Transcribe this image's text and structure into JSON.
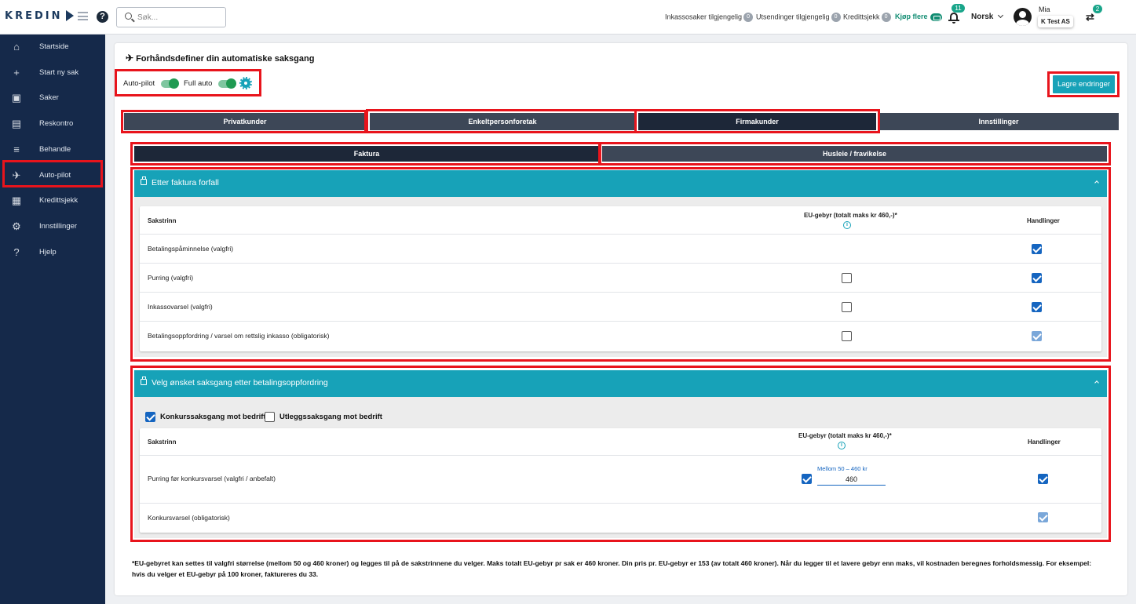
{
  "app": {
    "logo_text": "KREDIN"
  },
  "search": {
    "placeholder": "Søk..."
  },
  "header": {
    "stats": [
      {
        "label": "Inkassosaker tilgjengelig",
        "count": "0"
      },
      {
        "label": "Utsendinger tilgjengelig",
        "count": "0"
      },
      {
        "label": "Kredittsjekk",
        "count": "0"
      }
    ],
    "buy_more": "Kjøp flere",
    "notifications_count": "11",
    "language": "Norsk",
    "user_name": "Mia",
    "company": "K Test AS",
    "switch_count": "2"
  },
  "sidebar": {
    "items": [
      {
        "label": "Startside",
        "icon": "home-icon",
        "glyph": "⌂"
      },
      {
        "label": "Start ny sak",
        "icon": "plus-icon",
        "glyph": "+"
      },
      {
        "label": "Saker",
        "icon": "briefcase-icon",
        "glyph": "▣"
      },
      {
        "label": "Reskontro",
        "icon": "document-icon",
        "glyph": "▤"
      },
      {
        "label": "Behandle",
        "icon": "checklist-icon",
        "glyph": "≡"
      },
      {
        "label": "Auto-pilot",
        "icon": "airplane-icon",
        "glyph": "✈"
      },
      {
        "label": "Kredittsjekk",
        "icon": "id-card-icon",
        "glyph": "▦"
      },
      {
        "label": "Innstillinger",
        "icon": "gear-icon",
        "glyph": "⚙"
      },
      {
        "label": "Hjelp",
        "icon": "question-icon",
        "glyph": "?"
      }
    ],
    "active_index": 5
  },
  "page": {
    "title": "Forhåndsdefiner din automatiske saksgang",
    "autopilot_label": "Auto-pilot",
    "fullauto_label": "Full auto",
    "autopilot_on": true,
    "fullauto_on": true,
    "save_label": "Lagre endringer"
  },
  "customer_tabs": [
    {
      "label": "Privatkunder"
    },
    {
      "label": "Enkeltpersonforetak"
    },
    {
      "label": "Firmakunder"
    },
    {
      "label": "Innstillinger"
    }
  ],
  "customer_tab_active": 2,
  "type_tabs": [
    {
      "label": "Faktura"
    },
    {
      "label": "Husleie / fravikelse"
    }
  ],
  "type_tab_active": 0,
  "panel1": {
    "title": "Etter faktura forfall",
    "col_step": "Sakstrinn",
    "col_fee": "EU-gebyr (totalt maks kr 460,-)*",
    "col_actions": "Handlinger",
    "rows": [
      {
        "step": "Betalingspåminnelse (valgfri)",
        "fee": null,
        "action": "on"
      },
      {
        "step": "Purring (valgfri)",
        "fee": "off",
        "action": "on"
      },
      {
        "step": "Inkassovarsel (valgfri)",
        "fee": "off",
        "action": "on"
      },
      {
        "step": "Betalingsoppfordring / varsel om rettslig inkasso (obligatorisk)",
        "fee": "off",
        "action": "disabled"
      }
    ]
  },
  "panel2": {
    "title": "Velg ønsket saksgang etter betalingsoppfordring",
    "option1": "Konkurssaksgang mot bedrift",
    "option1_on": true,
    "option2": "Utleggssaksgang mot bedrift",
    "option2_on": false,
    "col_step": "Sakstrinn",
    "col_fee": "EU-gebyr (totalt maks kr 460,-)*",
    "col_actions": "Handlinger",
    "rows": [
      {
        "step": "Purring før konkursvarsel (valgfri / anbefalt)",
        "fee_hint": "Mellom 50 – 460 kr",
        "fee_value": "460",
        "fee_checked": true,
        "action": "on"
      },
      {
        "step": "Konkursvarsel (obligatorisk)",
        "action": "disabled"
      }
    ]
  },
  "footnote": "*EU-gebyret kan settes til valgfri størrelse (mellom 50 og 460 kroner) og legges til på de sakstrinnene du velger. Maks totalt EU-gebyr pr sak er 460 kroner. Din pris pr. EU-gebyr er 153 (av totalt 460 kroner). Når du legger til et lavere gebyr enn maks, vil kostnaden beregnes forholdsmessig. For eksempel: hvis du velger et EU-gebyr på 100 kroner, faktureres du 33."
}
